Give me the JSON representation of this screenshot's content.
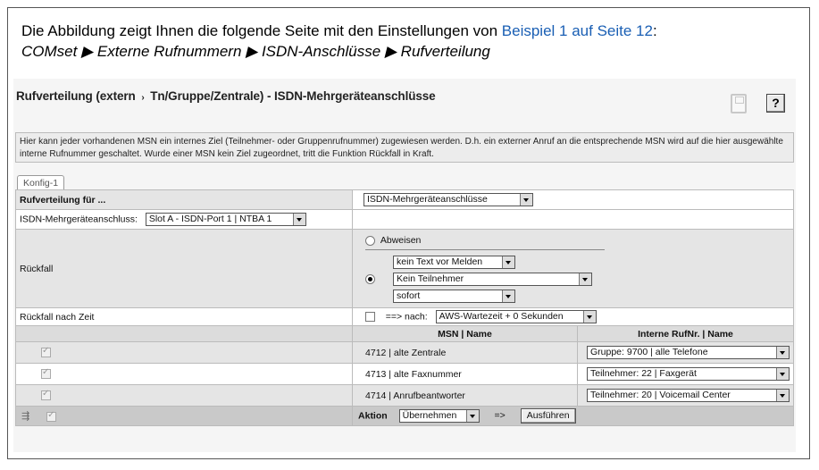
{
  "intro": {
    "line1_prefix": "Die Abbildung zeigt Ihnen die folgende Seite mit den Einstellungen von ",
    "link": "Beispiel 1 auf Seite 12",
    "line1_suffix": ":",
    "path": "COMset ▶ Externe Rufnummern ▶  ISDN-Anschlüsse ▶ Rufverteilung"
  },
  "panel": {
    "title_a": "Rufverteilung (extern",
    "title_arrow": "›",
    "title_b": "Tn/Gruppe/Zentrale) - ISDN-Mehrgeräteanschlüsse",
    "help_label": "?",
    "info": "Hier kann jeder vorhandenen MSN ein internes Ziel (Teilnehmer- oder Gruppenrufnummer) zugewiesen werden. D.h. ein externer Anruf an die entsprechende MSN wird auf die hier ausgewählte interne Rufnummer geschaltet. Wurde einer MSN kein Ziel zugeordnet, tritt die Funktion Rückfall in Kraft.",
    "tab": "Konfig-1"
  },
  "form": {
    "rufverteilung_label": "Rufverteilung für ...",
    "rufverteilung_value": "ISDN-Mehrgeräteanschlüsse",
    "anschluss_label": "ISDN-Mehrgeräteanschluss:",
    "anschluss_value": "Slot A - ISDN-Port 1 | NTBA 1",
    "rueckfall_label": "Rückfall",
    "abweisen_label": "Abweisen",
    "text_value": "kein Text vor Melden",
    "teilnehmer_value": "Kein Teilnehmer",
    "zeit_value": "sofort",
    "rueckfall_zeit_label": "Rückfall nach Zeit",
    "nach_label": "==> nach:",
    "nach_value": "AWS-Wartezeit + 0 Sekunden"
  },
  "table": {
    "col_msn": "MSN | Name",
    "col_intern": "Interne RufNr. | Name",
    "rows": [
      {
        "msn": "4712 | alte Zentrale",
        "intern": "Gruppe: 9700 | alle Telefone"
      },
      {
        "msn": "4713 | alte Faxnummer",
        "intern": "Teilnehmer: 22 | Faxgerät"
      },
      {
        "msn": "4714 | Anrufbeantworter",
        "intern": "Teilnehmer: 20 | Voicemail Center"
      }
    ]
  },
  "footer": {
    "aktion_label": "Aktion",
    "aktion_value": "Übernehmen",
    "arrow": "=>",
    "execute_label": "Ausführen"
  }
}
